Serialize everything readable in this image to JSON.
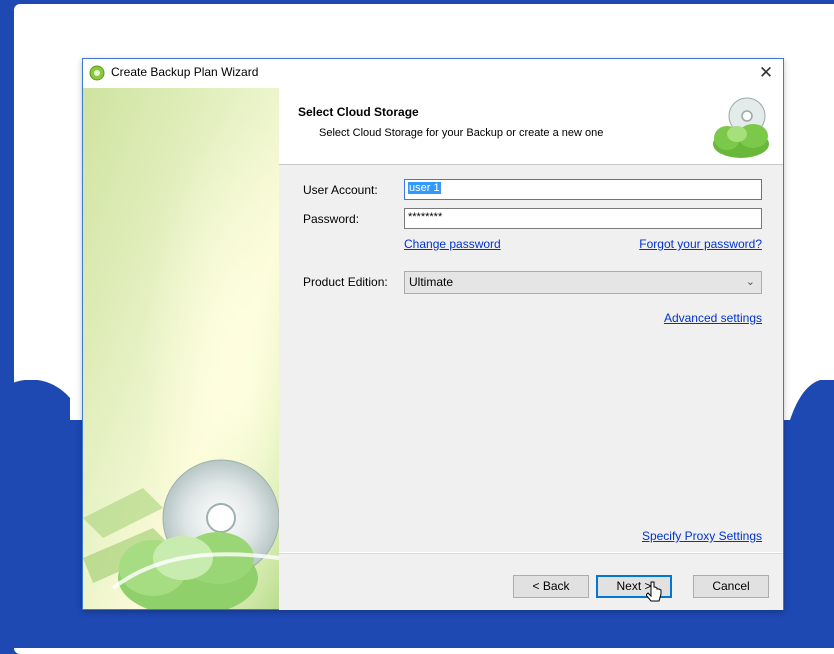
{
  "window": {
    "title": "Create Backup Plan Wizard",
    "close_glyph": "✕"
  },
  "header": {
    "title": "Select Cloud Storage",
    "description": "Select Cloud Storage for your Backup or create a new one",
    "icon": "cloud-disc-icon"
  },
  "form": {
    "user_account_label": "User Account:",
    "user_account_value": "user 1",
    "password_label": "Password:",
    "password_value": "********",
    "change_password_link": "Change password",
    "forgot_password_link": "Forgot your password?",
    "product_edition_label": "Product Edition:",
    "product_edition_value": "Ultimate",
    "advanced_settings_link": "Advanced settings",
    "proxy_settings_link": "Specify Proxy Settings"
  },
  "footer": {
    "back_label": "< Back",
    "next_label": "Next >",
    "cancel_label": "Cancel"
  },
  "colors": {
    "accent": "#0078d7",
    "link": "#0033cc",
    "backdrop": "#1e49b3"
  }
}
